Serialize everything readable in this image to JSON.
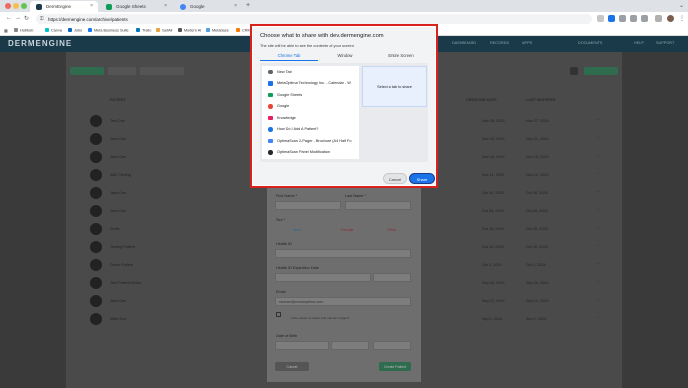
{
  "browser": {
    "tabs": [
      {
        "label": "DermEngine",
        "active": true
      },
      {
        "label": "Google Sheets",
        "active": false
      },
      {
        "label": "Google",
        "active": false
      }
    ],
    "url": "https://dermengine.com/archive/patients",
    "bookmarks": [
      "Hubbub",
      "Canva",
      "Jobs",
      "Meta Business Suite",
      "Trello",
      "GetAll",
      "Modern AI",
      "Metabase",
      "CRM"
    ]
  },
  "app": {
    "logo": "DERMENGINE",
    "nav": [
      "DASHBOARD",
      "RECORDS",
      "APPS",
      "DOCUMENTS",
      "HELP",
      "SUPPORT"
    ],
    "columns": [
      "PATIENT",
      "CREATION DATE",
      "LAST MODIFIED"
    ],
    "rows": [
      {
        "name": "Test Doe",
        "created": "Nov 26, 2024",
        "modified": "Nov 27, 2024"
      },
      {
        "name": "Jane Doe",
        "created": "Nov 20, 2024",
        "modified": "Nov 21, 2024"
      },
      {
        "name": "Jane Doe",
        "created": "Nov 15, 2024",
        "modified": "Nov 15, 2024"
      },
      {
        "name": "ABC Testing",
        "created": "Nov 11, 2024",
        "modified": "Nov 12, 2024"
      },
      {
        "name": "Jane Doe",
        "created": "Oct 30, 2024",
        "modified": "Oct 30, 2024"
      },
      {
        "name": "Jane Doe",
        "created": "Oct 28, 2024",
        "modified": "Oct 28, 2024"
      },
      {
        "name": "Smith",
        "created": "Oct 15, 2024",
        "modified": "Oct 15, 2024"
      },
      {
        "name": "Testing Patient",
        "created": "Oct 10, 2024",
        "modified": "Oct 10, 2024"
      },
      {
        "name": "Demo Patient",
        "created": "Oct 1, 2024",
        "modified": "Oct 1, 2024"
      },
      {
        "name": "Test Patient Demo",
        "created": "Sep 20, 2024",
        "modified": "Sep 20, 2024"
      },
      {
        "name": "John Doe",
        "created": "Sep 12, 2024",
        "modified": "Sep 12, 2024"
      },
      {
        "name": "Mark Doe",
        "created": "Sep 1, 2024",
        "modified": "Sep 1, 2024"
      }
    ]
  },
  "form": {
    "first_name_label": "First Name *",
    "last_name_label": "Last Name *",
    "sex_label": "Sex *",
    "sex_options": [
      "Male",
      "Female",
      "Other"
    ],
    "health_id_label": "Health ID",
    "health_id_exp_label": "Health ID Expiration Date",
    "email_label": "Email",
    "email_value": "rachael@metaoptima.com",
    "consent_text": "Invite patient to obtain and transfer images?",
    "dob_label": "Date of Birth",
    "cancel_label": "Cancel",
    "create_label": "Create Patient"
  },
  "share_dialog": {
    "title": "Choose what to share with dev.dermengine.com",
    "subtitle": "The site will be able to see the contents of your screen",
    "tabs": [
      "Chrome Tab",
      "Window",
      "Entire Screen"
    ],
    "items": [
      {
        "label": "New Tab",
        "icon": "chrome-icon",
        "color": "#5f6368"
      },
      {
        "label": "MetaOptima Technology Inc. - Calendar - W",
        "icon": "calendar-icon",
        "color": "#1a73e8"
      },
      {
        "label": "Google Sheets",
        "icon": "sheets-icon",
        "color": "#0f9d58"
      },
      {
        "label": "Google",
        "icon": "google-icon",
        "color": "#ea4335"
      },
      {
        "label": "Knowledge",
        "icon": "knowledge-icon",
        "color": "#e91e63"
      },
      {
        "label": "How Do I Add A Patient?",
        "icon": "help-icon",
        "color": "#1a73e8"
      },
      {
        "label": "OptimaScan 2-Pager - Brochure (A4 Half Fo",
        "icon": "doc-icon",
        "color": "#4285f4"
      },
      {
        "label": "OptimaScan Panel Modification",
        "icon": "github-icon",
        "color": "#24292e"
      }
    ],
    "preview_text": "Select a tab to share",
    "cancel_label": "Cancel",
    "share_label": "Share"
  }
}
